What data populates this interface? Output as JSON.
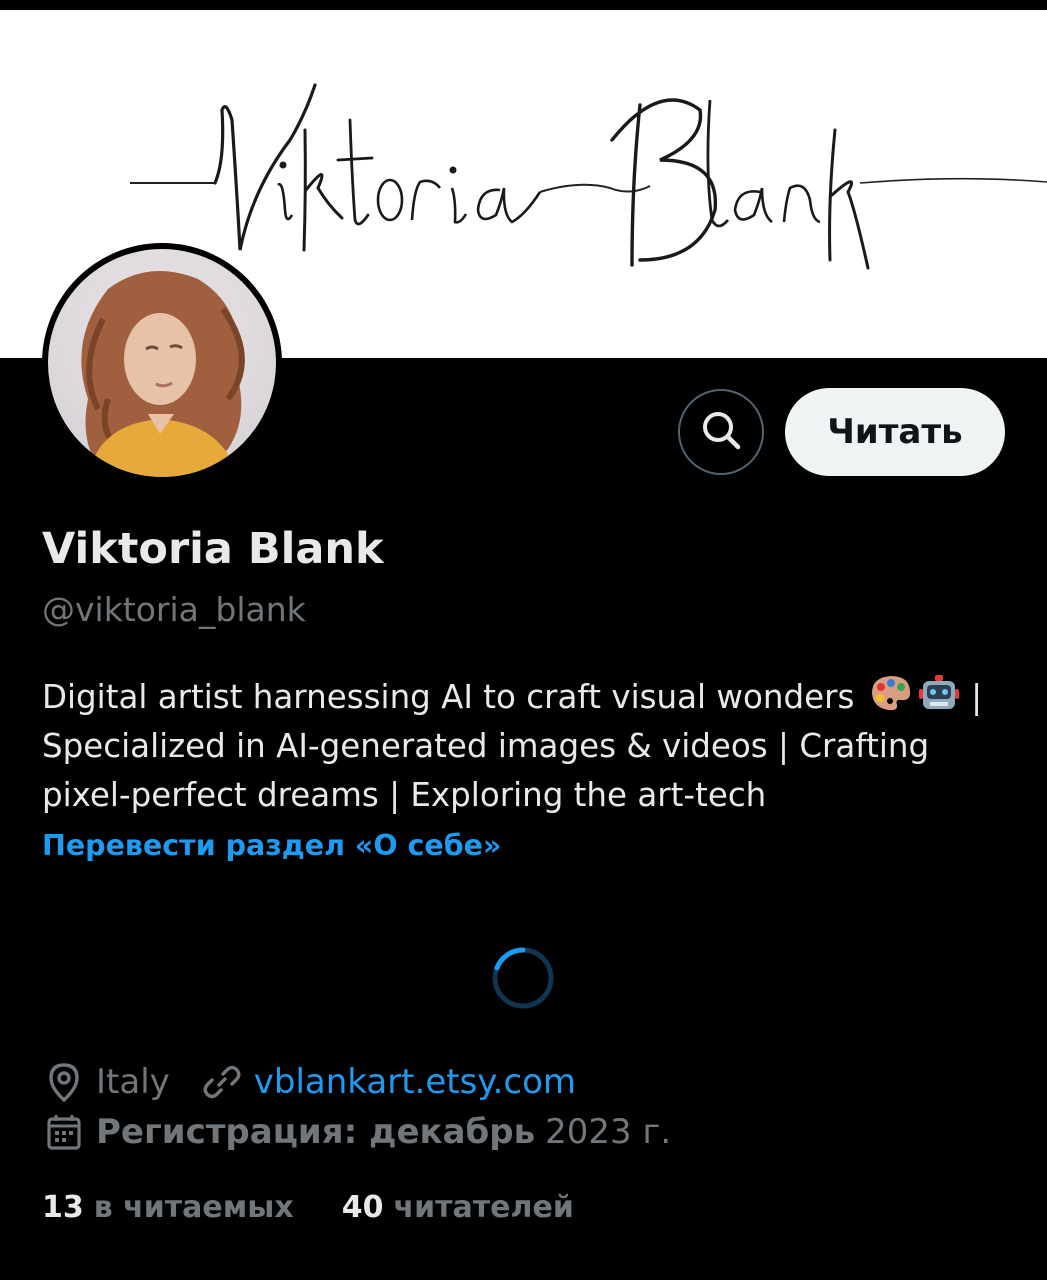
{
  "banner": {
    "lettering": "Viktoria Blank",
    "background": "#ffffff",
    "ink": "#1a1a1a"
  },
  "profile": {
    "display_name": "Viktoria Blank",
    "handle": "@viktoria_blank",
    "avatar_icon": "profile-photo"
  },
  "actions": {
    "search_icon": "search-icon",
    "follow_label": "Читать"
  },
  "bio": {
    "line1": "Digital artist harnessing AI to craft visual wonders",
    "line1_suffix": "|",
    "line2": "Specialized in AI-generated images & videos | Crafting",
    "line3": "pixel-perfect dreams | Exploring the art-tech",
    "emojis": [
      "palette-emoji",
      "robot-emoji"
    ],
    "translate_link": "Перевести раздел «О себе»"
  },
  "loading": {
    "spinner_icon": "loading-spinner-icon"
  },
  "meta": {
    "location": "Italy",
    "location_icon": "location-pin-icon",
    "website": "vblankart.etsy.com",
    "website_icon": "link-icon",
    "join_label": "Регистрация: декабрь",
    "join_date": "2023 г.",
    "join_icon": "calendar-icon"
  },
  "stats": {
    "following_count": "13",
    "following_label": "в читаемых",
    "followers_count": "40",
    "followers_label": "читателей"
  },
  "colors": {
    "background": "#000000",
    "primary_text": "#e7e9ea",
    "secondary_text": "#71767b",
    "accent": "#1d9bf0",
    "button_bg": "#eff3f4"
  }
}
